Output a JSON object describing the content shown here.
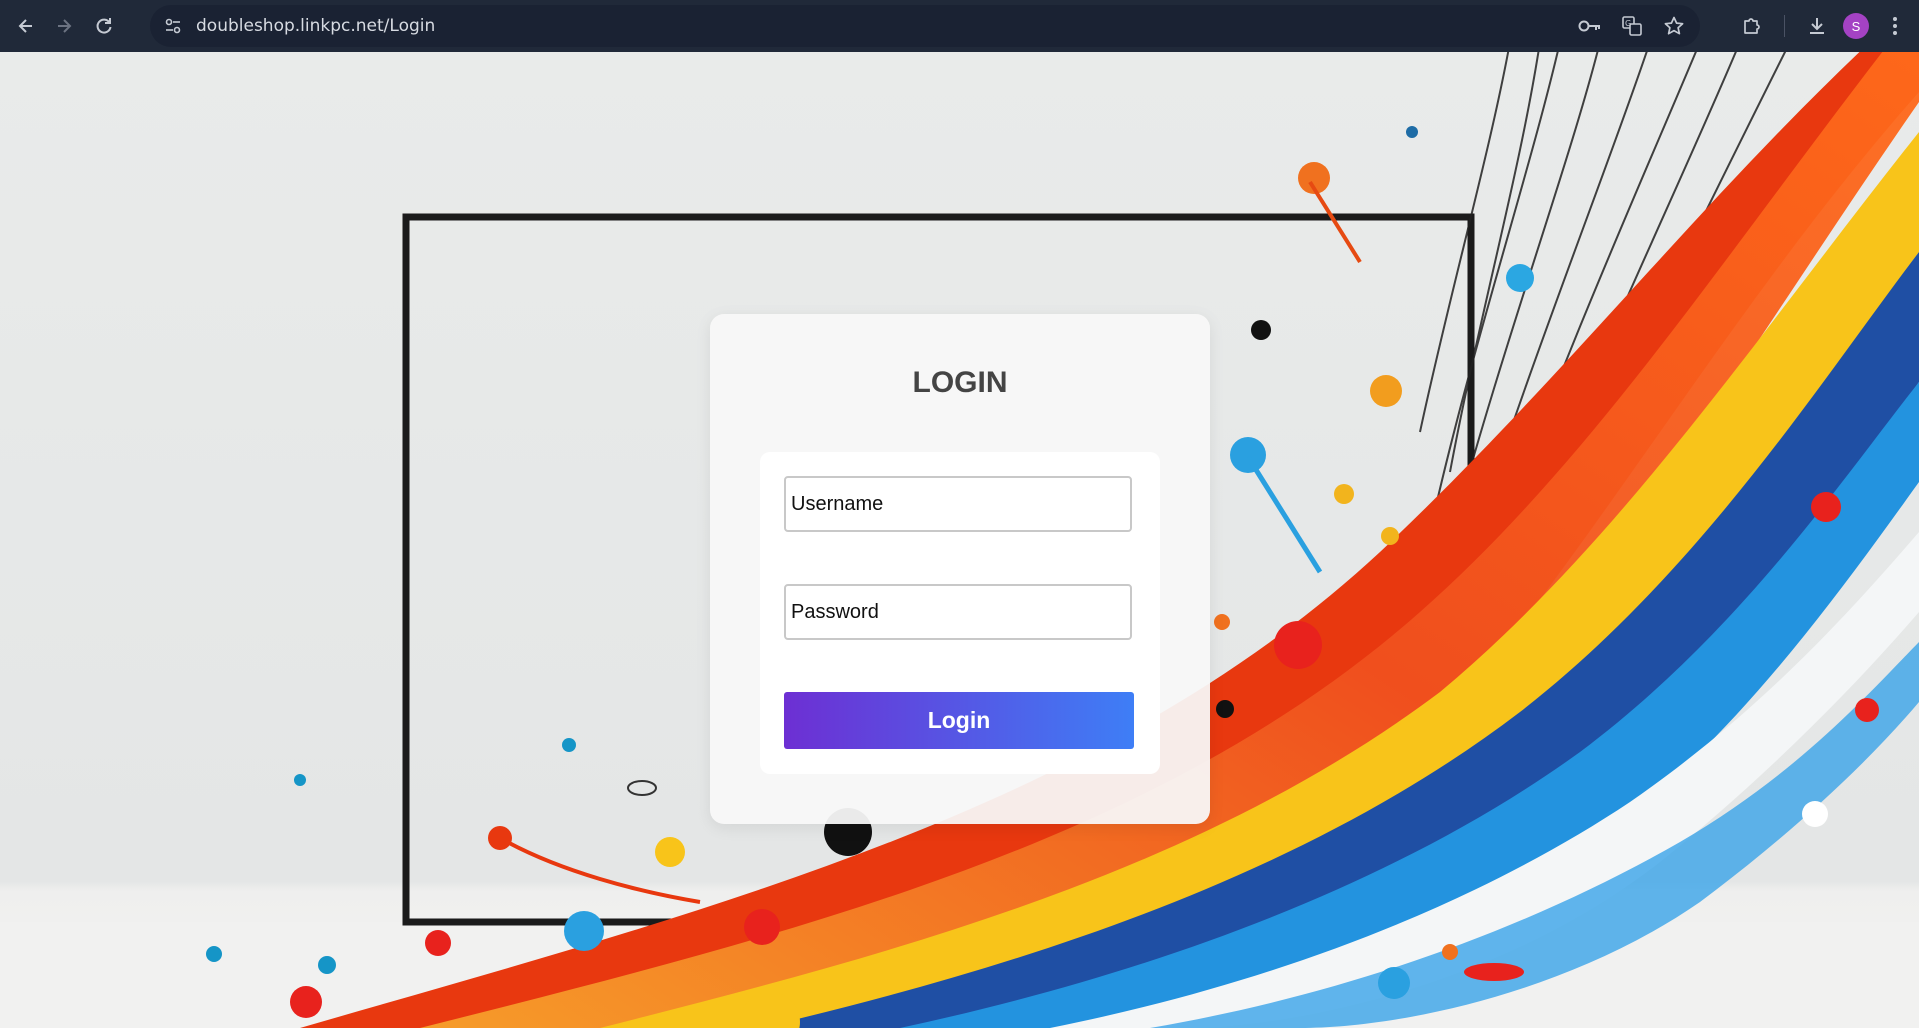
{
  "browser": {
    "url": "doubleshop.linkpc.net/Login",
    "profile_initial": "S",
    "icons": {
      "back": "back-arrow-icon",
      "forward": "forward-arrow-icon",
      "reload": "reload-icon",
      "site_info": "site-settings-icon",
      "password": "key-icon",
      "translate": "translate-icon",
      "bookmark": "star-icon",
      "extensions": "puzzle-icon",
      "downloads": "download-icon",
      "menu": "kebab-menu-icon"
    }
  },
  "login": {
    "title": "LOGIN",
    "username_placeholder": "Username",
    "password_placeholder": "Password",
    "button_label": "Login",
    "button_gradient": [
      "#6d2fd3",
      "#3e7ef6"
    ]
  }
}
